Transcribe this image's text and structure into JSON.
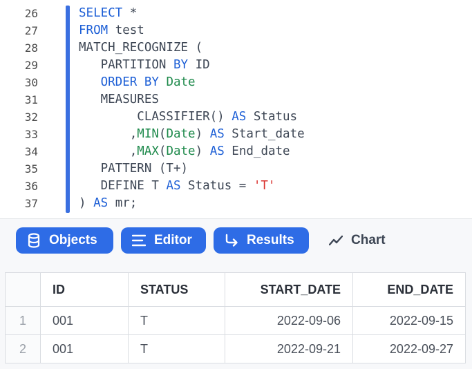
{
  "editor": {
    "lines": [
      {
        "num": "26",
        "tokens": [
          {
            "t": "SELECT",
            "c": "kw"
          },
          {
            "t": " *",
            "c": "plain"
          }
        ]
      },
      {
        "num": "27",
        "tokens": [
          {
            "t": "FROM",
            "c": "kw"
          },
          {
            "t": " test",
            "c": "plain"
          }
        ]
      },
      {
        "num": "28",
        "tokens": [
          {
            "t": "MATCH_RECOGNIZE (",
            "c": "plain"
          }
        ]
      },
      {
        "num": "29",
        "tokens": [
          {
            "t": "   PARTITION ",
            "c": "plain"
          },
          {
            "t": "BY",
            "c": "kw"
          },
          {
            "t": " ID",
            "c": "plain"
          }
        ]
      },
      {
        "num": "30",
        "tokens": [
          {
            "t": "   ",
            "c": "plain"
          },
          {
            "t": "ORDER BY",
            "c": "kw"
          },
          {
            "t": " ",
            "c": "plain"
          },
          {
            "t": "Date",
            "c": "fn"
          }
        ]
      },
      {
        "num": "31",
        "tokens": [
          {
            "t": "   MEASURES",
            "c": "plain"
          }
        ]
      },
      {
        "num": "32",
        "tokens": [
          {
            "t": "        CLASSIFIER() ",
            "c": "plain"
          },
          {
            "t": "AS",
            "c": "kw"
          },
          {
            "t": " Status",
            "c": "plain"
          }
        ]
      },
      {
        "num": "33",
        "tokens": [
          {
            "t": "       ,",
            "c": "plain"
          },
          {
            "t": "MIN",
            "c": "fn"
          },
          {
            "t": "(",
            "c": "plain"
          },
          {
            "t": "Date",
            "c": "fn"
          },
          {
            "t": ") ",
            "c": "plain"
          },
          {
            "t": "AS",
            "c": "kw"
          },
          {
            "t": " Start_date",
            "c": "plain"
          }
        ]
      },
      {
        "num": "34",
        "tokens": [
          {
            "t": "       ,",
            "c": "plain"
          },
          {
            "t": "MAX",
            "c": "fn"
          },
          {
            "t": "(",
            "c": "plain"
          },
          {
            "t": "Date",
            "c": "fn"
          },
          {
            "t": ") ",
            "c": "plain"
          },
          {
            "t": "AS",
            "c": "kw"
          },
          {
            "t": " End_date",
            "c": "plain"
          }
        ]
      },
      {
        "num": "35",
        "tokens": [
          {
            "t": "   PATTERN (T+)",
            "c": "plain"
          }
        ]
      },
      {
        "num": "36",
        "tokens": [
          {
            "t": "   DEFINE T ",
            "c": "plain"
          },
          {
            "t": "AS",
            "c": "kw"
          },
          {
            "t": " Status = ",
            "c": "plain"
          },
          {
            "t": "'T'",
            "c": "str"
          }
        ]
      },
      {
        "num": "37",
        "tokens": [
          {
            "t": ") ",
            "c": "plain"
          },
          {
            "t": "AS",
            "c": "kw"
          },
          {
            "t": " mr;",
            "c": "plain"
          }
        ]
      }
    ]
  },
  "toolbar": {
    "objects_label": "Objects",
    "editor_label": "Editor",
    "results_label": "Results",
    "chart_label": "Chart",
    "accent_color": "#2e6ce6"
  },
  "results": {
    "columns": [
      "ID",
      "STATUS",
      "START_DATE",
      "END_DATE"
    ],
    "rows": [
      {
        "n": "1",
        "id": "001",
        "status": "T",
        "start": "2022-09-06",
        "end": "2022-09-15"
      },
      {
        "n": "2",
        "id": "001",
        "status": "T",
        "start": "2022-09-21",
        "end": "2022-09-27"
      }
    ]
  }
}
